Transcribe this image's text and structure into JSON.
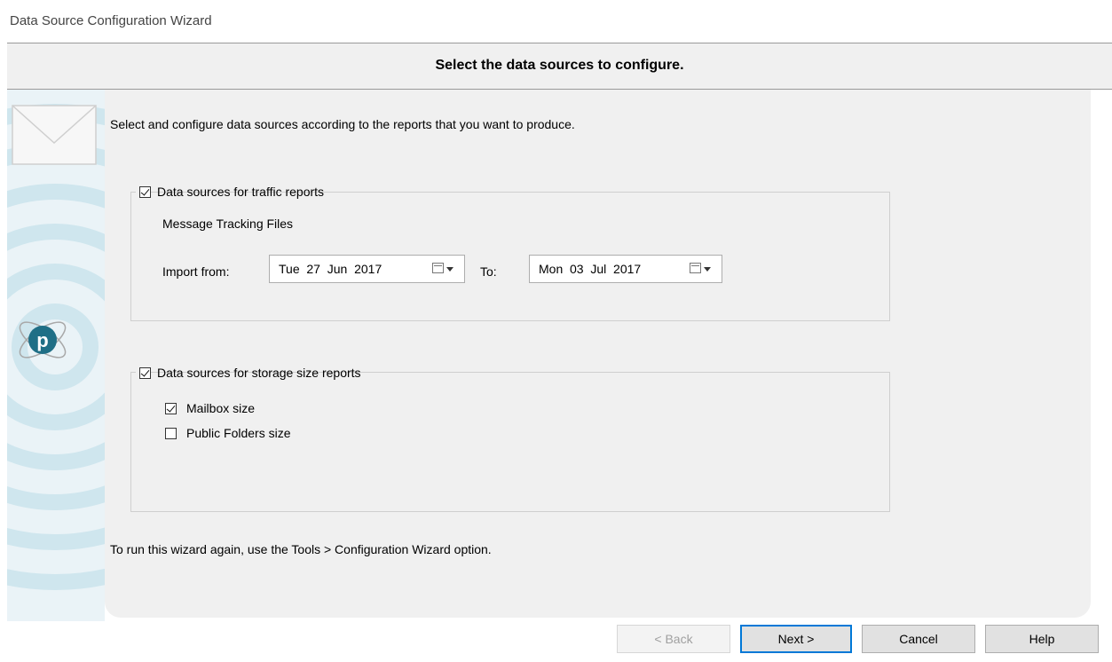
{
  "window": {
    "title": "Data Source Configuration Wizard"
  },
  "header": {
    "title": "Select the data sources to configure."
  },
  "intro": "Select and configure data sources according to the reports that you want to produce.",
  "traffic_group": {
    "checked": true,
    "label": "Data sources for traffic reports",
    "subheading": "Message Tracking Files",
    "import_from_label": "Import from:",
    "import_from_value": "Tue  27  Jun  2017",
    "to_label": "To:",
    "to_value": "Mon  03  Jul  2017"
  },
  "storage_group": {
    "checked": true,
    "label": "Data sources for storage size reports",
    "options": [
      {
        "label": "Mailbox size",
        "checked": true
      },
      {
        "label": "Public Folders size",
        "checked": false
      }
    ]
  },
  "footnote": "To run this wizard again, use the Tools > Configuration Wizard option.",
  "buttons": {
    "back": "< Back",
    "next": "Next >",
    "cancel": "Cancel",
    "help": "Help"
  },
  "colors": {
    "accent": "#0078d7",
    "panel": "#f0f0f0",
    "swirl": "#bfe0ea"
  }
}
